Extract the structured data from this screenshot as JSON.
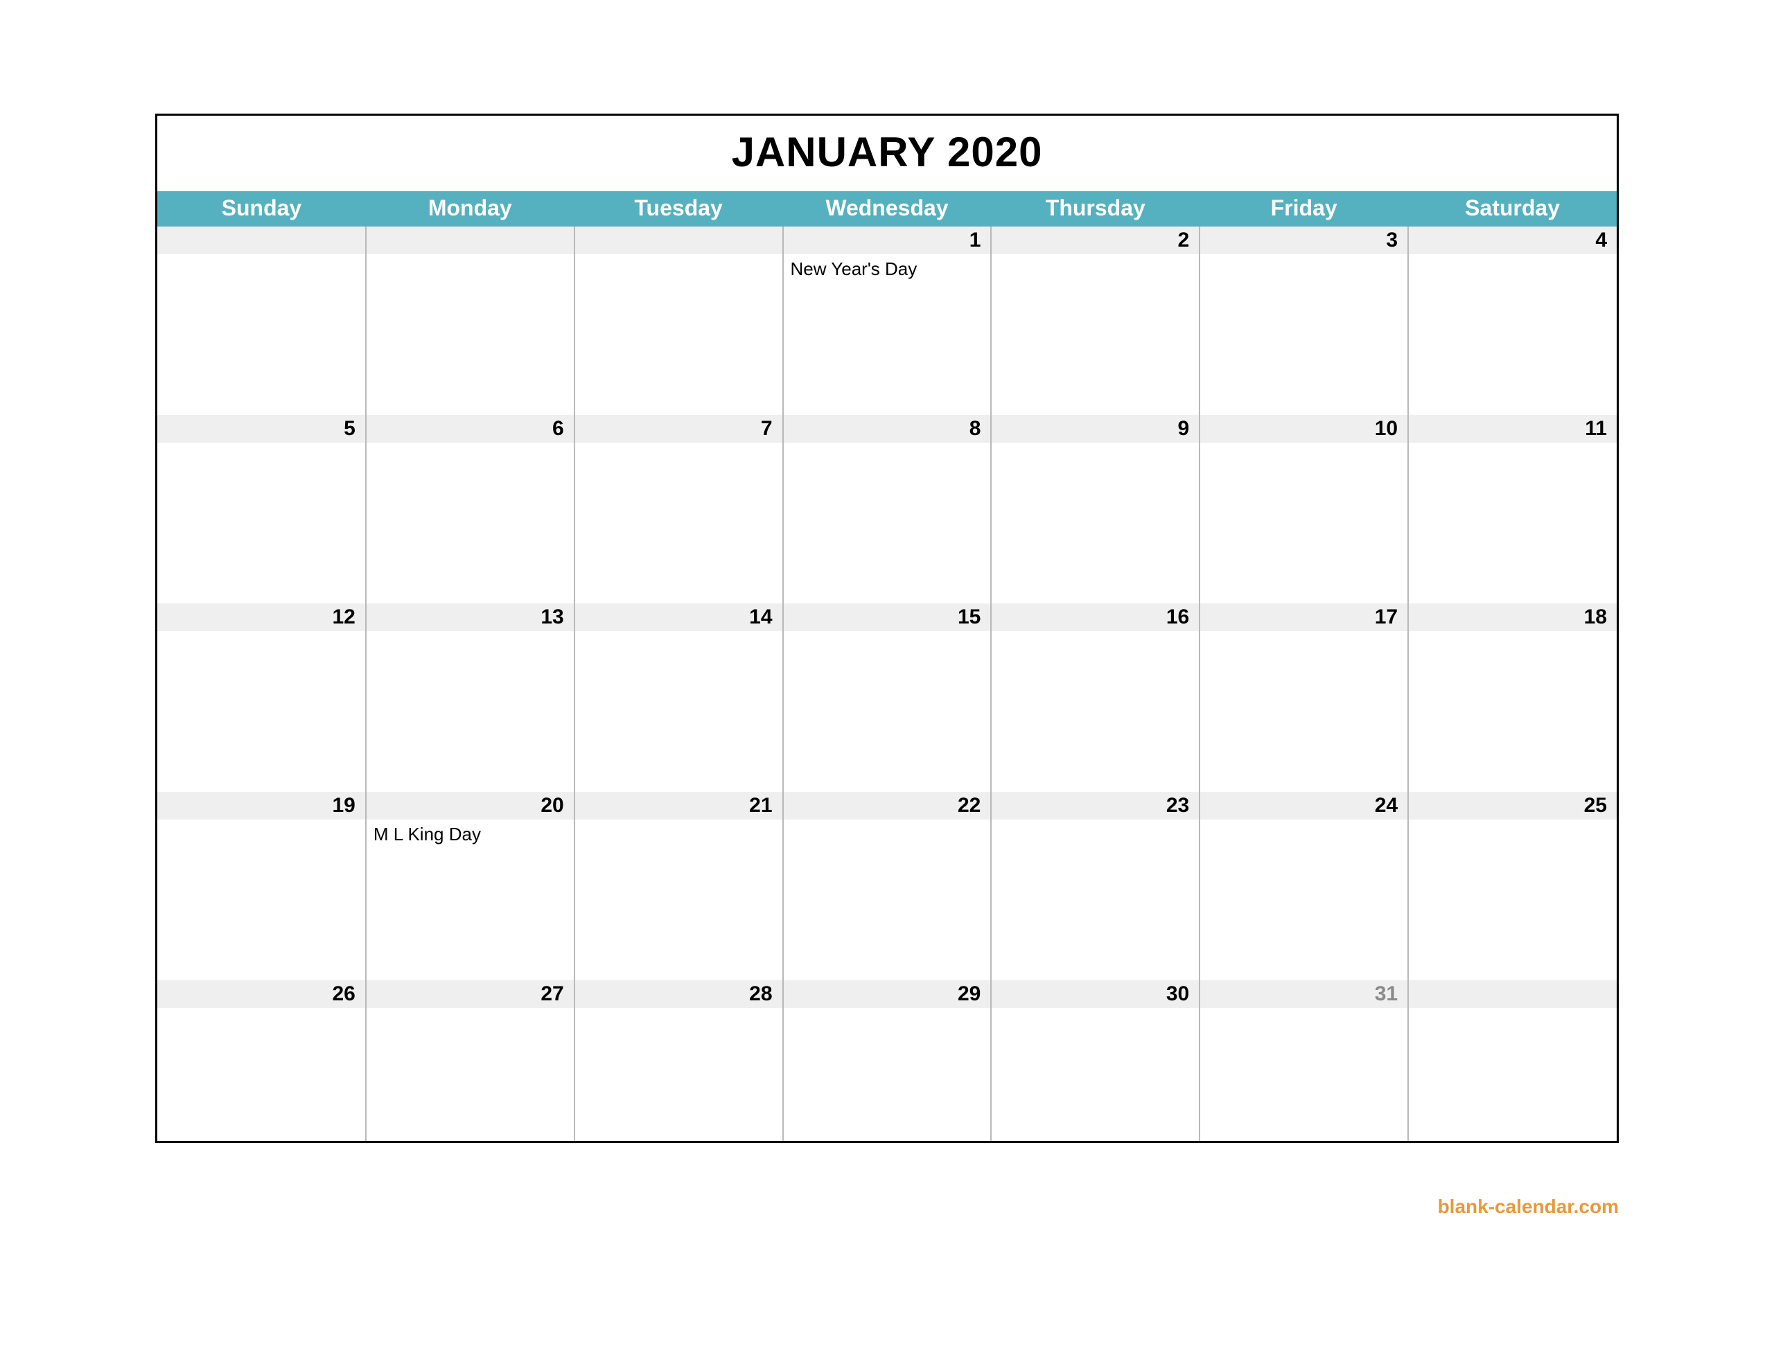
{
  "title": "JANUARY 2020",
  "credit": "blank-calendar.com",
  "days_of_week": [
    "Sunday",
    "Monday",
    "Tuesday",
    "Wednesday",
    "Thursday",
    "Friday",
    "Saturday"
  ],
  "weeks": [
    [
      {
        "num": "",
        "event": "",
        "dim": false
      },
      {
        "num": "",
        "event": "",
        "dim": false
      },
      {
        "num": "",
        "event": "",
        "dim": false
      },
      {
        "num": "1",
        "event": "New Year's Day",
        "dim": false
      },
      {
        "num": "2",
        "event": "",
        "dim": false
      },
      {
        "num": "3",
        "event": "",
        "dim": false
      },
      {
        "num": "4",
        "event": "",
        "dim": false
      }
    ],
    [
      {
        "num": "5",
        "event": "",
        "dim": false
      },
      {
        "num": "6",
        "event": "",
        "dim": false
      },
      {
        "num": "7",
        "event": "",
        "dim": false
      },
      {
        "num": "8",
        "event": "",
        "dim": false
      },
      {
        "num": "9",
        "event": "",
        "dim": false
      },
      {
        "num": "10",
        "event": "",
        "dim": false
      },
      {
        "num": "11",
        "event": "",
        "dim": false
      }
    ],
    [
      {
        "num": "12",
        "event": "",
        "dim": false
      },
      {
        "num": "13",
        "event": "",
        "dim": false
      },
      {
        "num": "14",
        "event": "",
        "dim": false
      },
      {
        "num": "15",
        "event": "",
        "dim": false
      },
      {
        "num": "16",
        "event": "",
        "dim": false
      },
      {
        "num": "17",
        "event": "",
        "dim": false
      },
      {
        "num": "18",
        "event": "",
        "dim": false
      }
    ],
    [
      {
        "num": "19",
        "event": "",
        "dim": false
      },
      {
        "num": "20",
        "event": "M L King Day",
        "dim": false
      },
      {
        "num": "21",
        "event": "",
        "dim": false
      },
      {
        "num": "22",
        "event": "",
        "dim": false
      },
      {
        "num": "23",
        "event": "",
        "dim": false
      },
      {
        "num": "24",
        "event": "",
        "dim": false
      },
      {
        "num": "25",
        "event": "",
        "dim": false
      }
    ],
    [
      {
        "num": "26",
        "event": "",
        "dim": false
      },
      {
        "num": "27",
        "event": "",
        "dim": false
      },
      {
        "num": "28",
        "event": "",
        "dim": false
      },
      {
        "num": "29",
        "event": "",
        "dim": false
      },
      {
        "num": "30",
        "event": "",
        "dim": false
      },
      {
        "num": "31",
        "event": "",
        "dim": true
      },
      {
        "num": "",
        "event": "",
        "dim": false
      }
    ]
  ]
}
